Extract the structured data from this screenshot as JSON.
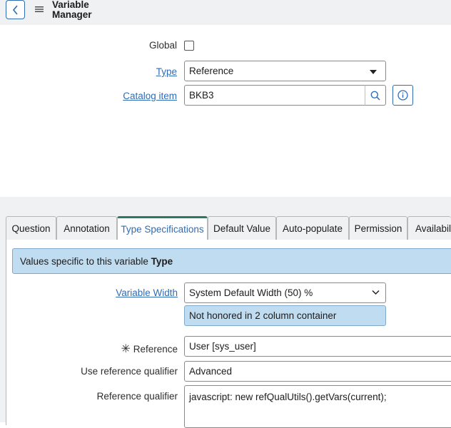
{
  "header": {
    "title_line1": "Variable",
    "title_line2": "Manager"
  },
  "form": {
    "global_label": "Global",
    "type_label": "Type",
    "type_value": "Reference",
    "catalog_item_label": "Catalog item",
    "catalog_item_value": "BKB3"
  },
  "tabs": [
    {
      "label": "Question"
    },
    {
      "label": "Annotation"
    },
    {
      "label": "Type Specifications"
    },
    {
      "label": "Default Value"
    },
    {
      "label": "Auto-populate"
    },
    {
      "label": "Permission"
    },
    {
      "label": "Availabili"
    }
  ],
  "active_tab": "Type Specifications",
  "type_spec": {
    "info_prefix": "Values specific to this variable ",
    "info_bold": "Type",
    "variable_width_label": "Variable Width",
    "variable_width_value": "System Default Width (50) %",
    "variable_width_notice": "Not honored in 2 column container",
    "reference_label": "Reference",
    "reference_value": "User [sys_user]",
    "use_ref_qualifier_label": "Use reference qualifier",
    "use_ref_qualifier_value": "Advanced",
    "ref_qualifier_label": "Reference qualifier",
    "ref_qualifier_value": "javascript: new refQualUtils().getVars(current);"
  },
  "colors": {
    "link": "#2f6cb3",
    "info_bg": "#c0dcf0",
    "active_tab_border": "#2a7a63"
  }
}
